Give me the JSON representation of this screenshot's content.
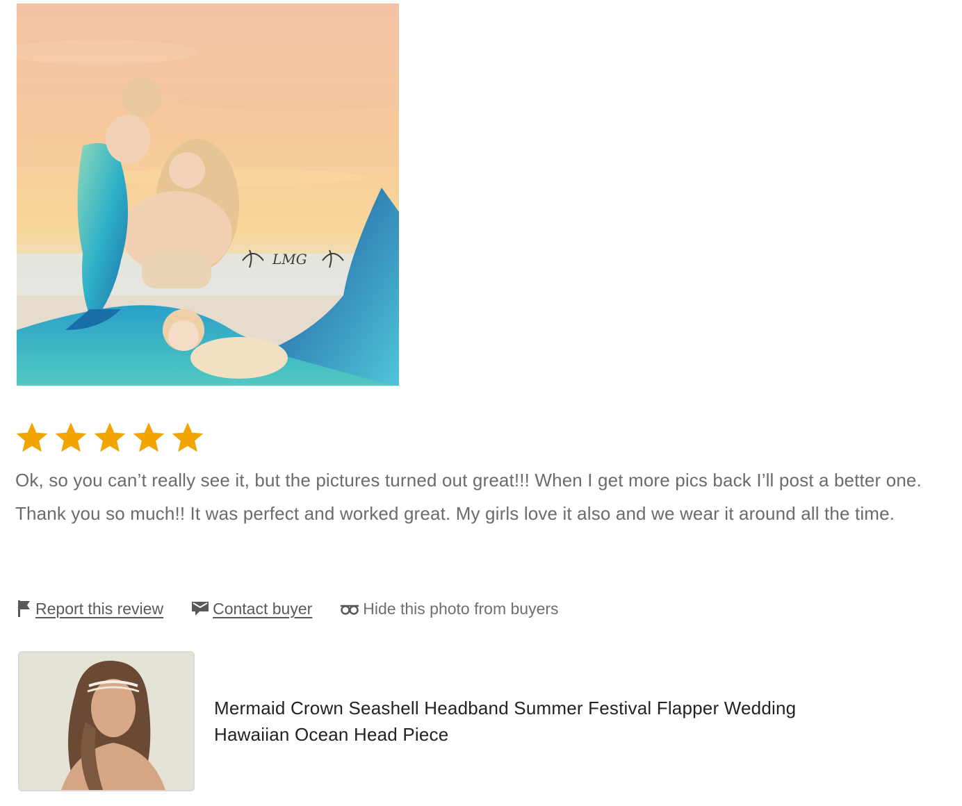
{
  "review": {
    "photo_icon": "review-photo",
    "photo_watermark": "LMG",
    "rating": 5,
    "rating_max": 5,
    "star_color": "#f2a500",
    "text": "Ok, so you can’t really see it, but the pictures turned out great!!! When I get more pics back I’ll post a better one. Thank you so much!! It was perfect and worked great. My girls love it also and we wear it around all the time."
  },
  "actions": {
    "report": {
      "label": " Report this review",
      "icon": "flag-icon"
    },
    "contact": {
      "label": "Contact buyer",
      "icon": "message-icon"
    },
    "hide": {
      "label": "Hide this photo from buyers",
      "icon": "hide-eye-icon"
    }
  },
  "listing": {
    "thumb_icon": "listing-thumbnail",
    "title": "Mermaid Crown Seashell Headband Summer Festival Flapper Wedding Hawaiian Ocean Head Piece"
  }
}
